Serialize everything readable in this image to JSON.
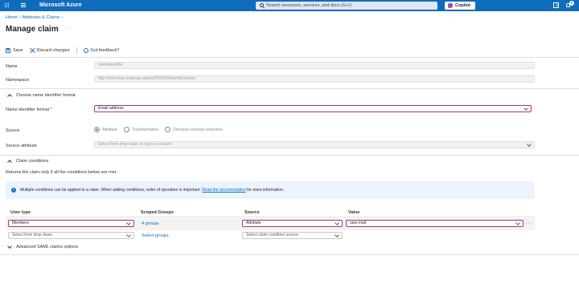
{
  "topbar": {
    "brand": "Microsoft Azure",
    "search_placeholder": "Search resources, services, and docs (G+/)",
    "copilot_label": "Copilot",
    "notification_count": "6"
  },
  "breadcrumb": [
    "Home",
    "Attributes & Claims"
  ],
  "page": {
    "title": "Manage claim",
    "more": "···"
  },
  "commands": {
    "save": "Save",
    "discard": "Discard changes",
    "feedback": "Got feedback?"
  },
  "form": {
    "name_label": "Name",
    "name_value": "nameidentifier",
    "namespace_label": "Namespace",
    "namespace_value": "http://schemas.xmlsoap.org/ws/2005/05/identity/claims",
    "section_name_id": "Choose name identifier format",
    "name_id_format_label": "Name identifier format",
    "required_mark": "*",
    "name_id_format_value": "Email address",
    "source_label": "Source",
    "source_options": [
      "Attribute",
      "Transformation",
      "Directory schema extension"
    ],
    "source_selected": "Attribute",
    "source_attribute_label": "Source attribute",
    "source_attribute_placeholder": "Select from drop down or type a constant"
  },
  "conditions": {
    "section_title": "Claim conditions",
    "note": "Returns the claim only if all the conditions below are met.",
    "info_text": "Multiple conditions can be applied to a claim.  When adding conditions, order of operation is important.",
    "info_link": "Read the documentation",
    "info_suffix": "for more information.",
    "columns": [
      "User type",
      "Scoped Groups",
      "Source",
      "Value"
    ],
    "rows": [
      {
        "user_type": "Members",
        "scoped_groups": "4 groups",
        "source": "Attribute",
        "value": "user.mail"
      }
    ],
    "new_row": {
      "user_type": "Select from drop down",
      "scoped_groups": "Select groups",
      "source": "Select claim condition source."
    }
  },
  "advanced": {
    "title": "Advanced SAML claims options"
  },
  "colors": {
    "accent": "#0f6cbd",
    "focus_border": "#a8328e",
    "info_bg": "#ebf3fc"
  }
}
